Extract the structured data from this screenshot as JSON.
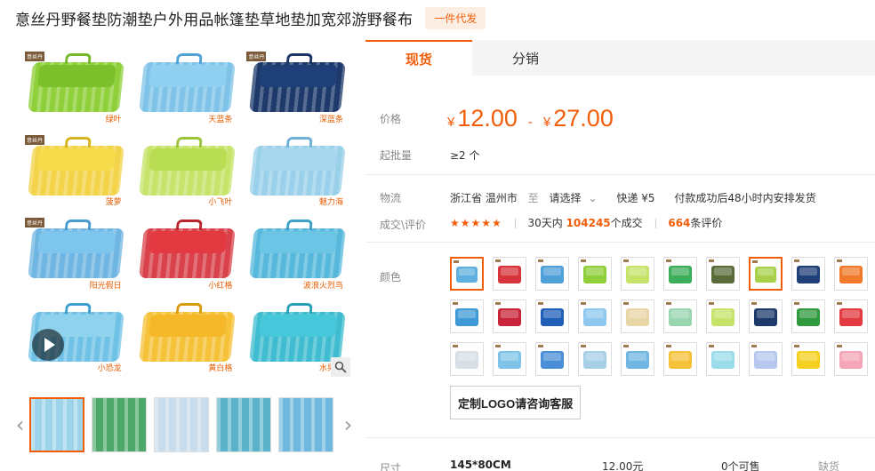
{
  "product": {
    "title": "意丝丹野餐垫防潮垫户外用品帐篷垫草地垫加宽郊游野餐布",
    "badge": "一件代发"
  },
  "gallery": {
    "brand_tag": "意丝丹",
    "cells": [
      {
        "caption": "绿叶",
        "color": "#8fcf3a",
        "flap": "#7cc12c",
        "handle": "#76b82c"
      },
      {
        "caption": "天蓝条",
        "color": "#7fc4e8",
        "flap": "#8fd0f0",
        "handle": "#4fa2d8"
      },
      {
        "caption": "深蓝条",
        "color": "#1d3a6b",
        "flap": "#1f3f78",
        "handle": "#1b3566"
      },
      {
        "caption": "菠萝",
        "color": "#f3d34a",
        "flap": "#f6dc4a",
        "handle": "#d6b41e"
      },
      {
        "caption": "小飞叶",
        "color": "#c6e36a",
        "flap": "#b8dc52",
        "handle": "#9cc43a"
      },
      {
        "caption": "魅力海",
        "color": "#9bd0ea",
        "flap": "#a6d7ef",
        "handle": "#6fb0d8"
      },
      {
        "caption": "阳光假日",
        "color": "#6fb6e2",
        "flap": "#7fc6ee",
        "handle": "#4a9ad2"
      },
      {
        "caption": "小红格",
        "color": "#d9424a",
        "flap": "#e23a40",
        "handle": "#b8262e"
      },
      {
        "caption": "波浪火烈鸟",
        "color": "#57b8dc",
        "flap": "#6bc6e6",
        "handle": "#3fa0c8"
      },
      {
        "caption": "小恐龙",
        "color": "#6fc2e6",
        "flap": "#8fd2ee",
        "handle": "#3c9fd0"
      },
      {
        "caption": "黄白格",
        "color": "#f6c23a",
        "flap": "#f5b829",
        "handle": "#d99a10"
      },
      {
        "caption": "水果格",
        "color": "#3fbcd0",
        "flap": "#46c8da",
        "handle": "#2aa0b6"
      }
    ],
    "thumbs": [
      {
        "color": "#9ed4ea",
        "active": true
      },
      {
        "color": "#4ea86a",
        "active": false
      },
      {
        "color": "#c8dceb",
        "active": false
      },
      {
        "color": "#5bb3c9",
        "active": false
      },
      {
        "color": "#6fb8de",
        "active": false
      }
    ],
    "prev_arrow": "‹",
    "next_arrow": "›",
    "zoom_icon": "magnifier-icon"
  },
  "tabs": [
    {
      "label": "现货",
      "active": true
    },
    {
      "label": "分销",
      "active": false
    }
  ],
  "price": {
    "label": "价格",
    "currency": "¥",
    "low": "12.00",
    "dash": "-",
    "high": "27.00"
  },
  "moq": {
    "label": "起批量",
    "value": "≥2 个"
  },
  "logistics": {
    "label": "物流",
    "origin": "浙江省 温州市",
    "to": "至",
    "destination": "请选择",
    "shipping": "快递 ¥5",
    "promise": "付款成功后48小时内安排发货"
  },
  "review": {
    "label": "成交\\评价",
    "stars": "★★★★★",
    "days_label": "30天内",
    "deals": "104245",
    "deals_suffix": "个成交",
    "reviews": "664",
    "reviews_suffix": "条评价"
  },
  "color": {
    "label": "颜色",
    "swatches": [
      {
        "c": "#5fb0de",
        "sel": true
      },
      {
        "c": "#d8343c",
        "sel": false
      },
      {
        "c": "#4f9fd8",
        "sel": false
      },
      {
        "c": "#8fcf3a",
        "sel": false
      },
      {
        "c": "#c6e36a",
        "sel": false
      },
      {
        "c": "#3cae5a",
        "sel": false
      },
      {
        "c": "#5a6b3a",
        "sel": false
      },
      {
        "c": "#a8d04a",
        "sel": true
      },
      {
        "c": "#1f3f78",
        "sel": false
      },
      {
        "c": "#f07a2a",
        "sel": false
      },
      {
        "c": "#3f9ad6",
        "sel": false
      },
      {
        "c": "#c8243a",
        "sel": false
      },
      {
        "c": "#1f5fb8",
        "sel": false
      },
      {
        "c": "#8fc8ee",
        "sel": false
      },
      {
        "c": "#e8d6a6",
        "sel": false
      },
      {
        "c": "#9ad6b0",
        "sel": false
      },
      {
        "c": "#c6e36a",
        "sel": false
      },
      {
        "c": "#1d3a6b",
        "sel": false
      },
      {
        "c": "#2f9a3e",
        "sel": false
      },
      {
        "c": "#e23a40",
        "sel": false
      },
      {
        "c": "#d8dfe6",
        "sel": false
      },
      {
        "c": "#7fc4e8",
        "sel": false
      },
      {
        "c": "#4a8ed6",
        "sel": false
      },
      {
        "c": "#a7cfe6",
        "sel": false
      },
      {
        "c": "#6fb6e2",
        "sel": false
      },
      {
        "c": "#f6c23a",
        "sel": false
      },
      {
        "c": "#9bdcea",
        "sel": false
      },
      {
        "c": "#b6c8ee",
        "sel": false
      },
      {
        "c": "#f5d020",
        "sel": false
      },
      {
        "c": "#f4a6b8",
        "sel": false
      }
    ]
  },
  "custom_logo": "定制LOGO请咨询客服",
  "size_row": {
    "label": "尺寸",
    "size": "145*80CM",
    "price": "12.00元",
    "stock": "0个可售",
    "status": "缺货"
  }
}
